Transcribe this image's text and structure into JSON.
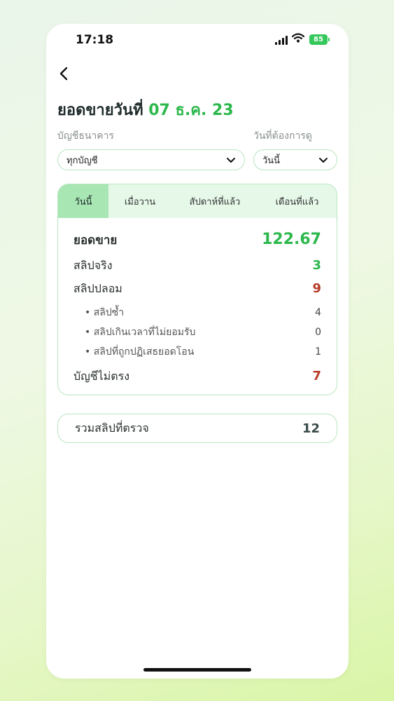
{
  "status_bar": {
    "time": "17:18",
    "battery": "85"
  },
  "header": {
    "title": "ยอดขายวันที่",
    "date": "07 ธ.ค. 23"
  },
  "filters": {
    "account_label": "บัญชีธนาคาร",
    "account_value": "ทุกบัญชี",
    "period_label": "วันที่ต้องการดู",
    "period_value": "วันนี้"
  },
  "tabs": [
    {
      "label": "วันนี้",
      "active": true
    },
    {
      "label": "เมื่อวาน",
      "active": false
    },
    {
      "label": "สัปดาห์ที่แล้ว",
      "active": false
    },
    {
      "label": "เดือนที่แล้ว",
      "active": false
    }
  ],
  "summary": {
    "sales_label": "ยอดขาย",
    "sales_value": "122.67",
    "real_slip_label": "สลิปจริง",
    "real_slip_value": "3",
    "fake_slip_label": "สลิปปลอม",
    "fake_slip_value": "9",
    "sub_items": [
      {
        "label": "• สลิปซ้ำ",
        "value": "4"
      },
      {
        "label": "• สลิปเกินเวลาที่ไม่ยอมรับ",
        "value": "0"
      },
      {
        "label": "• สลิปที่ถูกปฏิเสธยอดโอน",
        "value": "1"
      }
    ],
    "mismatch_label": "บัญชีไม่ตรง",
    "mismatch_value": "7"
  },
  "total": {
    "label": "รวมสลิปที่ตรวจ",
    "value": "12"
  },
  "colors": {
    "accent_green": "#2db84d",
    "warning_red": "#b93c2a",
    "border": "#b8e6bf"
  }
}
